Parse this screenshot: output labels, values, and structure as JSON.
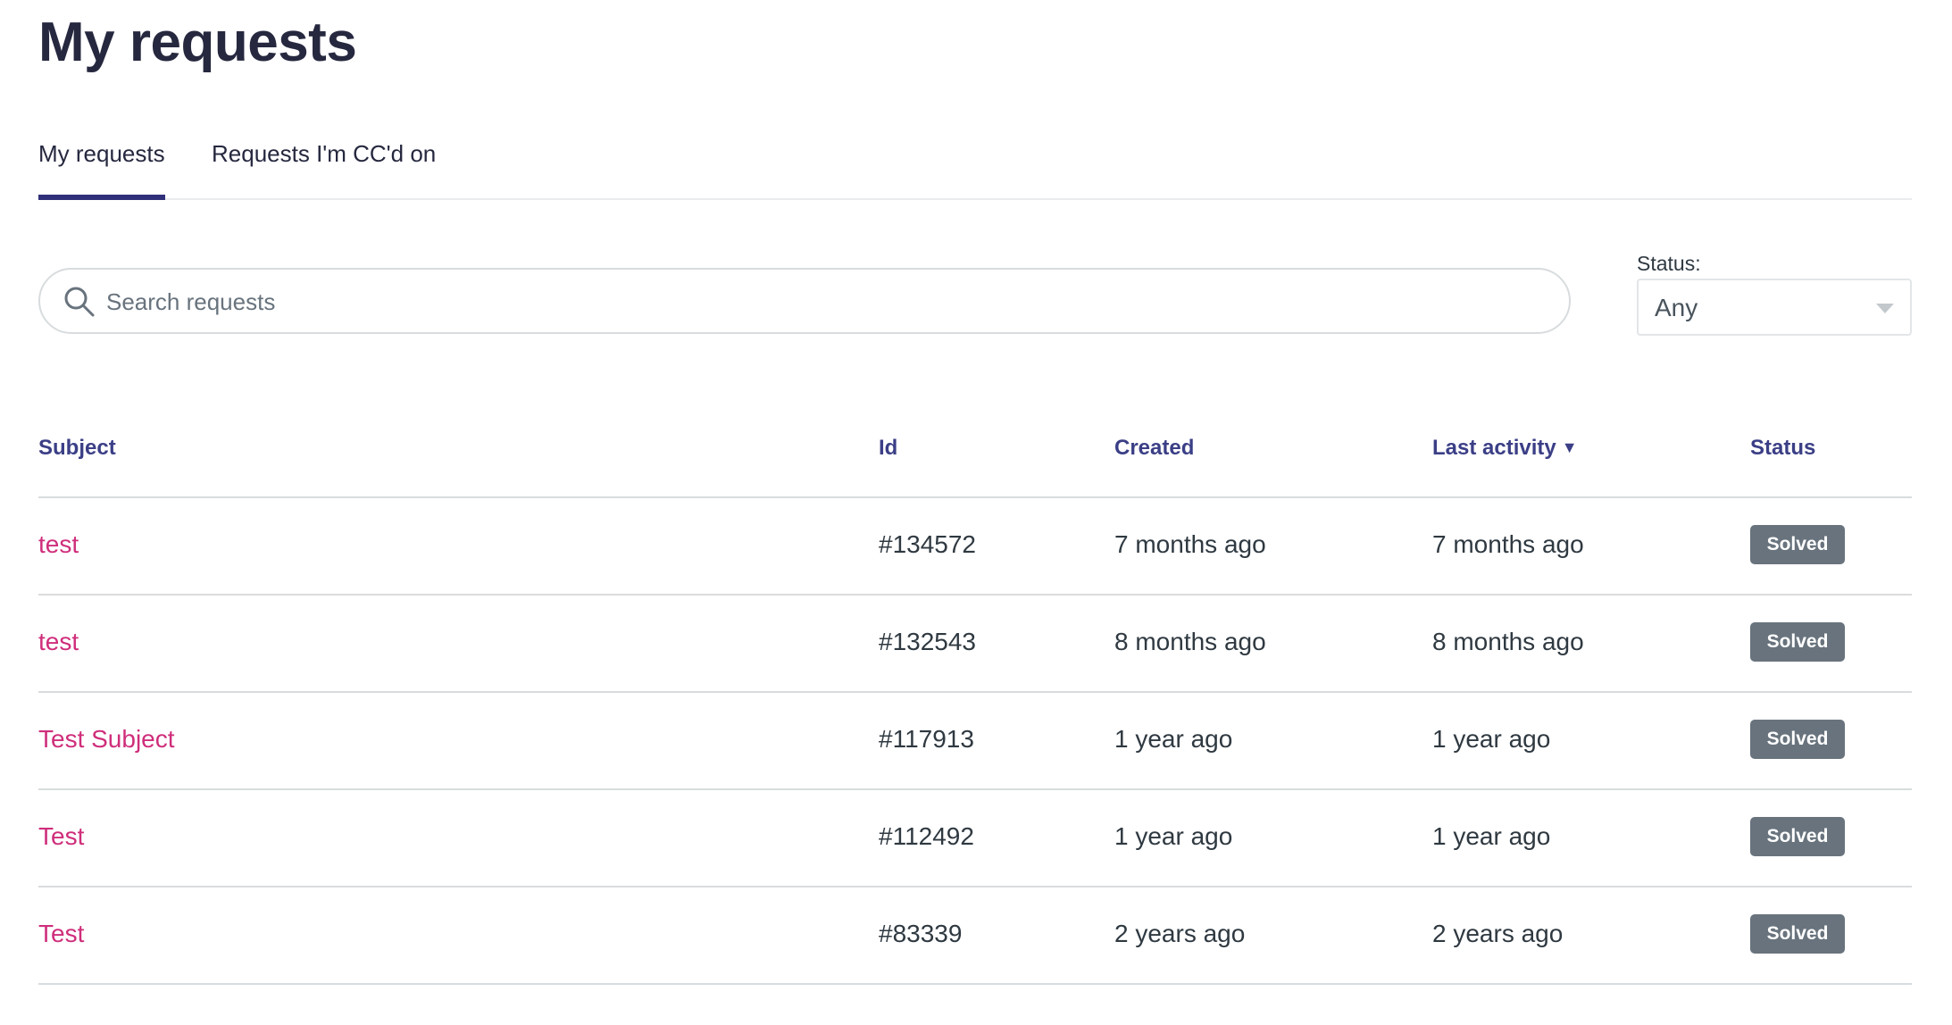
{
  "page": {
    "title": "My requests"
  },
  "tabs": [
    {
      "label": "My requests",
      "active": true
    },
    {
      "label": "Requests I'm CC'd on",
      "active": false
    }
  ],
  "search": {
    "placeholder": "Search requests",
    "value": "",
    "icon": "search-icon"
  },
  "status_filter": {
    "label": "Status:",
    "value": "Any",
    "icon": "chevron-down-icon"
  },
  "table": {
    "columns": {
      "subject": "Subject",
      "id": "Id",
      "created": "Created",
      "last_activity": "Last activity",
      "last_activity_sort": "▼",
      "status": "Status"
    },
    "rows": [
      {
        "subject": "test",
        "id": "#134572",
        "created": "7 months ago",
        "last_activity": "7 months ago",
        "status": "Solved"
      },
      {
        "subject": "test",
        "id": "#132543",
        "created": "8 months ago",
        "last_activity": "8 months ago",
        "status": "Solved"
      },
      {
        "subject": "Test Subject",
        "id": "#117913",
        "created": "1 year ago",
        "last_activity": "1 year ago",
        "status": "Solved"
      },
      {
        "subject": "Test",
        "id": "#112492",
        "created": "1 year ago",
        "last_activity": "1 year ago",
        "status": "Solved"
      },
      {
        "subject": "Test",
        "id": "#83339",
        "created": "2 years ago",
        "last_activity": "2 years ago",
        "status": "Solved"
      }
    ]
  },
  "colors": {
    "title": "#26283f",
    "accent": "#30307a",
    "header_text": "#3b3f86",
    "link": "#cf2e7b",
    "badge_bg": "#68737d"
  }
}
